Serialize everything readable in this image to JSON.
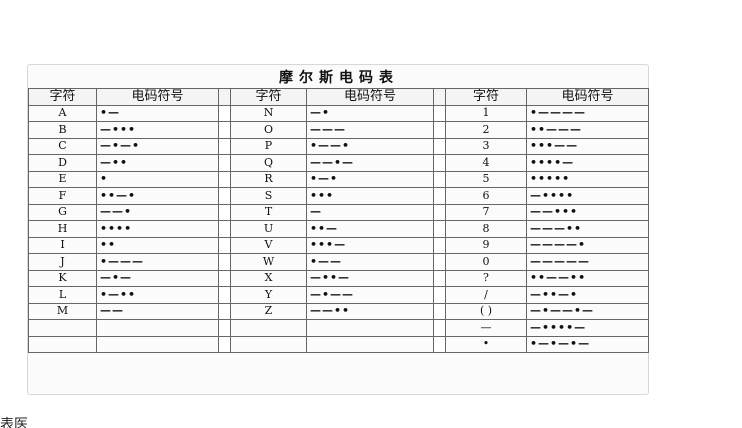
{
  "table": {
    "title": "摩尔斯电码表",
    "headers": {
      "char": "字符",
      "code": "电码符号"
    },
    "rows": [
      {
        "c1": "A",
        "m1": "•—",
        "c2": "N",
        "m2": "—•",
        "c3": "1",
        "m3": "•————"
      },
      {
        "c1": "B",
        "m1": "—•••",
        "c2": "O",
        "m2": "———",
        "c3": "2",
        "m3": "••———"
      },
      {
        "c1": "C",
        "m1": "—•—•",
        "c2": "P",
        "m2": "•——•",
        "c3": "3",
        "m3": "•••——"
      },
      {
        "c1": "D",
        "m1": "—••",
        "c2": "Q",
        "m2": "——•—",
        "c3": "4",
        "m3": "••••—"
      },
      {
        "c1": "E",
        "m1": "•",
        "c2": "R",
        "m2": "•—•",
        "c3": "5",
        "m3": "•••••"
      },
      {
        "c1": "F",
        "m1": "••—•",
        "c2": "S",
        "m2": "•••",
        "c3": "6",
        "m3": "—••••"
      },
      {
        "c1": "G",
        "m1": "——•",
        "c2": "T",
        "m2": "—",
        "c3": "7",
        "m3": "——•••"
      },
      {
        "c1": "H",
        "m1": "••••",
        "c2": "U",
        "m2": "••—",
        "c3": "8",
        "m3": "———••"
      },
      {
        "c1": "I",
        "m1": "••",
        "c2": "V",
        "m2": "•••—",
        "c3": "9",
        "m3": "————•"
      },
      {
        "c1": "J",
        "m1": "•———",
        "c2": "W",
        "m2": "•——",
        "c3": "0",
        "m3": "—————"
      },
      {
        "c1": "K",
        "m1": "—•—",
        "c2": "X",
        "m2": "—••—",
        "c3": "?",
        "m3": "••——••"
      },
      {
        "c1": "L",
        "m1": "•—••",
        "c2": "Y",
        "m2": "—•——",
        "c3": "/",
        "m3": "—••—•"
      },
      {
        "c1": "M",
        "m1": "——",
        "c2": "Z",
        "m2": "——••",
        "c3": "( )",
        "m3": "—•——•—"
      },
      {
        "c1": "",
        "m1": "",
        "c2": "",
        "m2": "",
        "c3": "—",
        "m3": "—••••—"
      },
      {
        "c1": "",
        "m1": "",
        "c2": "",
        "m2": "",
        "c3": "•",
        "m3": "•—•—•—"
      }
    ]
  },
  "footer_fragment": "表医"
}
